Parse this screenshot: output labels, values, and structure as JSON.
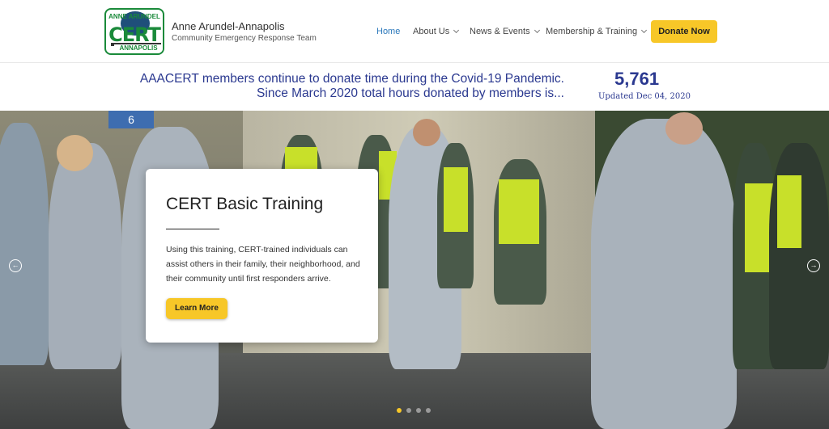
{
  "logo": {
    "top_text": "ANNE ARUNDEL",
    "main_text": "CERT",
    "bottom_text": "ANNAPOLIS"
  },
  "site": {
    "title": "Anne Arundel-Annapolis",
    "subtitle": "Community Emergency Response Team"
  },
  "nav": {
    "items": [
      {
        "label": "Home",
        "active": true
      },
      {
        "label": "About Us"
      },
      {
        "label": "News & Events"
      },
      {
        "label": "Membership & Training"
      }
    ],
    "donate_label": "Donate Now"
  },
  "banner": {
    "line1": "AAACERT members continue to donate time during the Covid-19 Pandemic.",
    "line2": "Since March 2020 total hours donated by members is...",
    "count": "5,761",
    "updated": "Updated Dec 04, 2020"
  },
  "hero": {
    "sign_text": "6",
    "slide_title": "CERT Basic Training",
    "slide_body": "Using this training, CERT-trained individuals can assist others in their family, their neighborhood, and their community until first responders arrive.",
    "cta_label": "Learn More",
    "slide_count": 4,
    "active_slide": 1
  },
  "colors": {
    "accent_yellow": "#f7c728",
    "brand_blue": "#2b3990",
    "link_blue": "#2b78bb",
    "logo_green": "#1a8a3a"
  },
  "icons": {
    "prev": "arrow-left-circle-icon",
    "next": "arrow-right-circle-icon",
    "dropdown": "chevron-down-icon"
  }
}
